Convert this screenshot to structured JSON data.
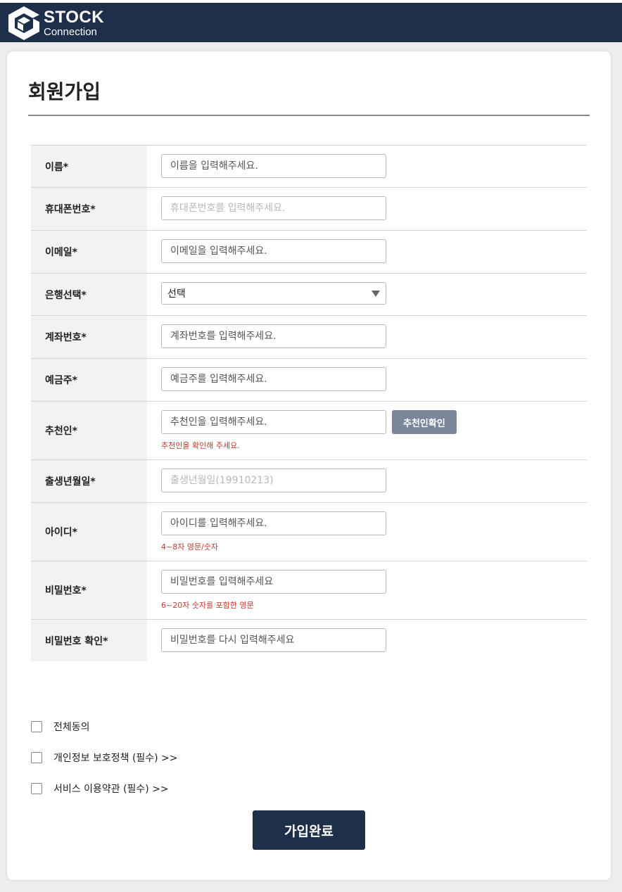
{
  "header": {
    "logo_top": "STOCK",
    "logo_bottom": "Connection",
    "bg_color": "#1e2f4a"
  },
  "page": {
    "title": "회원가입"
  },
  "form": {
    "name": {
      "label": "이름*",
      "placeholder": "이름을 입력해주세요."
    },
    "phone": {
      "label": "휴대폰번호*",
      "placeholder": "휴대폰번호를 입력해주세요."
    },
    "email": {
      "label": "이메일*",
      "placeholder": "이메일을 입력해주세요."
    },
    "bank": {
      "label": "은행선택*",
      "selected": "선택"
    },
    "account": {
      "label": "계좌번호*",
      "placeholder": "계좌번호를 입력해주세요."
    },
    "holder": {
      "label": "예금주*",
      "placeholder": "예금주를 입력해주세요."
    },
    "referrer": {
      "label": "추천인*",
      "placeholder": "추천인을 입력해주세요.",
      "button": "추천인확인",
      "hint": "추천인을 확인해 주세요."
    },
    "birth": {
      "label": "출생년월일*",
      "placeholder": "출생년월일(19910213)"
    },
    "userid": {
      "label": "아이디*",
      "placeholder": "아이디를 입력해주세요.",
      "hint": "4~8자 영문/숫자"
    },
    "password": {
      "label": "비밀번호*",
      "placeholder": "비밀번호를 입력해주세요",
      "hint": "6~20자 숫자를 포함한 영문"
    },
    "password_confirm": {
      "label": "비밀번호 확인*",
      "placeholder": "비밀번호를 다시 입력해주세요"
    }
  },
  "agreements": {
    "all": "전체동의",
    "privacy": "개인정보 보호정책 (필수) >>",
    "terms": "서비스 이용약관 (필수) >>"
  },
  "submit": {
    "label": "가입완료"
  }
}
